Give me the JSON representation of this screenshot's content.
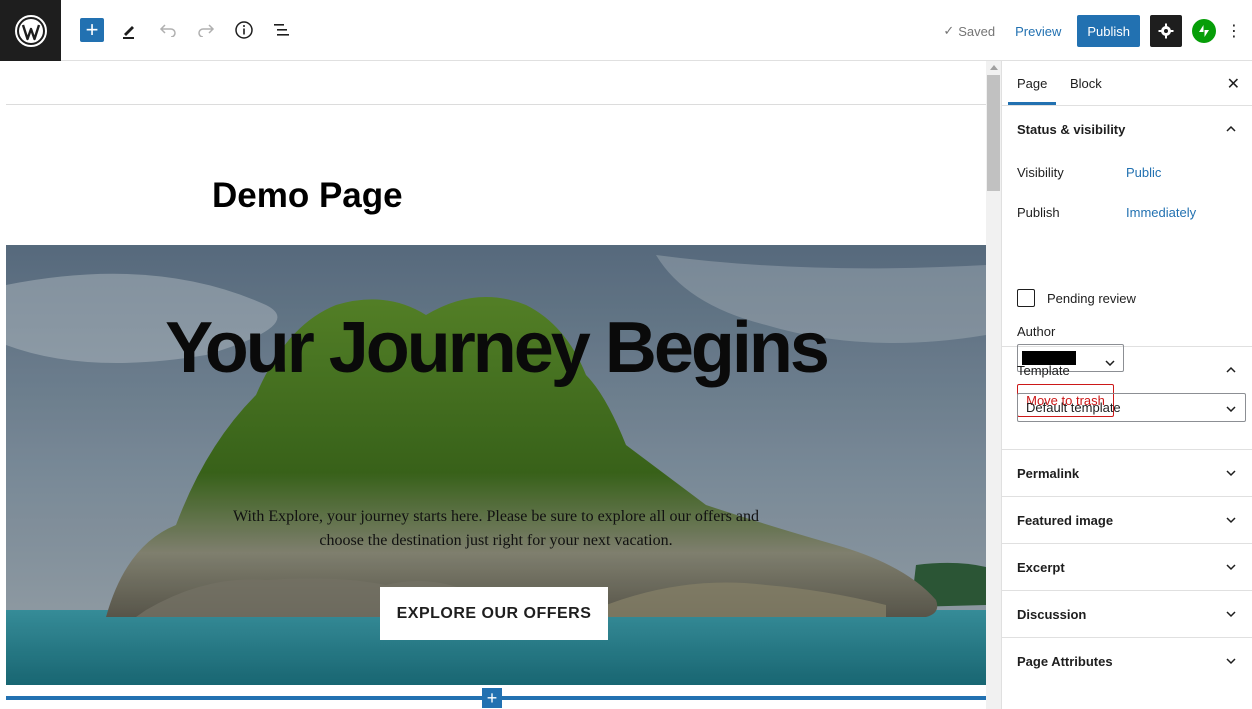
{
  "toolbar": {
    "saved_label": "Saved",
    "preview_label": "Preview",
    "publish_label": "Publish",
    "accent_color": "#2271b1"
  },
  "editor": {
    "page_title": "Demo Page",
    "cover": {
      "heading": "Your Journey Begins",
      "text": "With Explore, your journey starts here. Please be sure to explore all our offers and choose the destination just right for your next vacation.",
      "button_label": "EXPLORE OUR OFFERS"
    }
  },
  "sidebar": {
    "tabs": [
      "Page",
      "Block"
    ],
    "active_tab": "Page",
    "status": {
      "title": "Status & visibility",
      "visibility_label": "Visibility",
      "visibility_value": "Public",
      "publish_label": "Publish",
      "publish_value": "Immediately",
      "pending_label": "Pending review",
      "pending_checked": false,
      "author_label": "Author",
      "trash_label": "Move to trash"
    },
    "template": {
      "title": "Template",
      "selected": "Default template"
    },
    "panels": [
      "Permalink",
      "Featured image",
      "Excerpt",
      "Discussion",
      "Page Attributes"
    ]
  }
}
